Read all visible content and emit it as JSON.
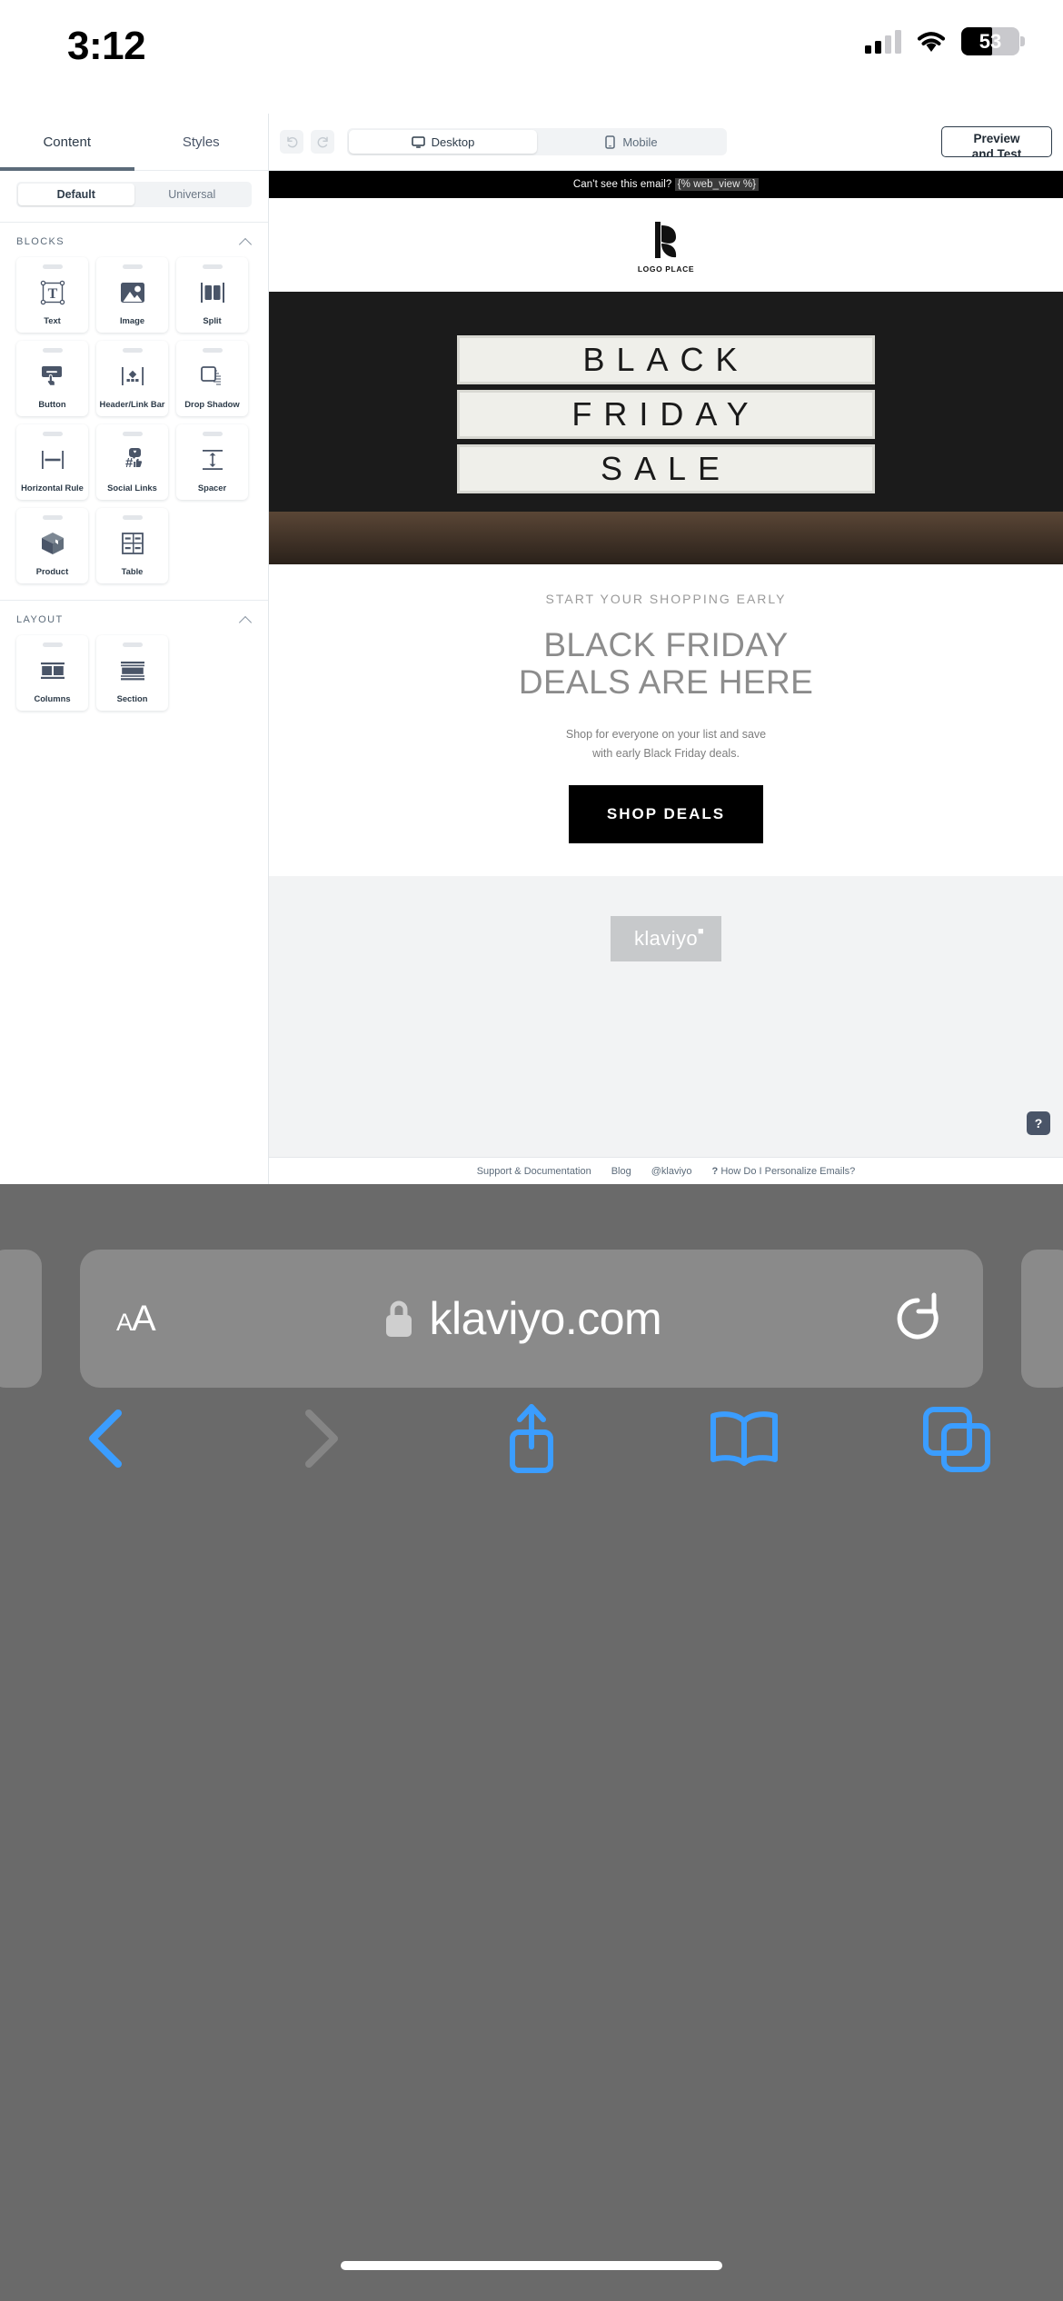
{
  "statusbar": {
    "time": "3:12",
    "battery_percent": "53",
    "signal_icon": "cellular-bars-icon",
    "wifi_icon": "wifi-icon"
  },
  "panel": {
    "tabs": [
      {
        "label": "Content",
        "active": true
      },
      {
        "label": "Styles",
        "active": false
      }
    ],
    "segment": [
      {
        "label": "Default",
        "selected": true
      },
      {
        "label": "Universal",
        "selected": false
      }
    ],
    "sections": [
      {
        "title": "BLOCKS",
        "collapse_icon": "chevron-up-icon",
        "items": [
          {
            "label": "Text",
            "icon": "text-block-icon"
          },
          {
            "label": "Image",
            "icon": "image-block-icon"
          },
          {
            "label": "Split",
            "icon": "split-block-icon"
          },
          {
            "label": "Button",
            "icon": "button-block-icon"
          },
          {
            "label": "Header/Link Bar",
            "icon": "header-link-bar-icon"
          },
          {
            "label": "Drop Shadow",
            "icon": "drop-shadow-icon"
          },
          {
            "label": "Horizontal Rule",
            "icon": "horizontal-rule-icon"
          },
          {
            "label": "Social Links",
            "icon": "social-links-icon"
          },
          {
            "label": "Spacer",
            "icon": "spacer-icon"
          },
          {
            "label": "Product",
            "icon": "product-box-icon"
          },
          {
            "label": "Table",
            "icon": "table-block-icon"
          }
        ]
      },
      {
        "title": "LAYOUT",
        "collapse_icon": "chevron-up-icon",
        "items": [
          {
            "label": "Columns",
            "icon": "columns-layout-icon"
          },
          {
            "label": "Section",
            "icon": "section-layout-icon"
          }
        ]
      }
    ]
  },
  "preview_toolbar": {
    "undo": "undo-icon",
    "redo": "redo-icon",
    "devices": [
      {
        "label": "Desktop",
        "icon": "desktop-icon",
        "selected": true
      },
      {
        "label": "Mobile",
        "icon": "mobile-icon",
        "selected": false
      }
    ],
    "preview_button_line1": "Preview",
    "preview_button_line2": "and Test"
  },
  "email": {
    "webview_text": "Can't see this email?",
    "webview_tag": "{% web_view %}",
    "logo_label": "LOGO PLACE",
    "hero_lines": [
      "BLACK",
      "FRIDAY",
      "SALE"
    ],
    "kicker": "START YOUR SHOPPING EARLY",
    "headline_line1": "BLACK FRIDAY",
    "headline_line2": "DEALS ARE HERE",
    "subcopy_line1": "Shop for everyone on your list and save",
    "subcopy_line2": "with early Black Friday deals.",
    "cta_label": "SHOP DEALS",
    "brand_badge": "klaviyo",
    "help_button": "?"
  },
  "page_footer": {
    "links": [
      "Support & Documentation",
      "Blog",
      "@klaviyo"
    ],
    "personalize_icon": "question-mark-icon",
    "personalize_label": "How Do I Personalize Emails?"
  },
  "safari": {
    "text_size_label": "A",
    "text_size_label_small": "A",
    "lock_icon": "lock-icon",
    "url": "klaviyo.com",
    "reload_icon": "reload-icon",
    "back_icon": "back-chevron-icon",
    "forward_icon": "forward-chevron-icon",
    "share_icon": "share-icon",
    "bookmarks_icon": "book-icon",
    "tabs_icon": "tabs-icon"
  },
  "colors": {
    "accent": "#007aff",
    "panel_text": "#2d3b49",
    "email_dark": "#000000"
  }
}
